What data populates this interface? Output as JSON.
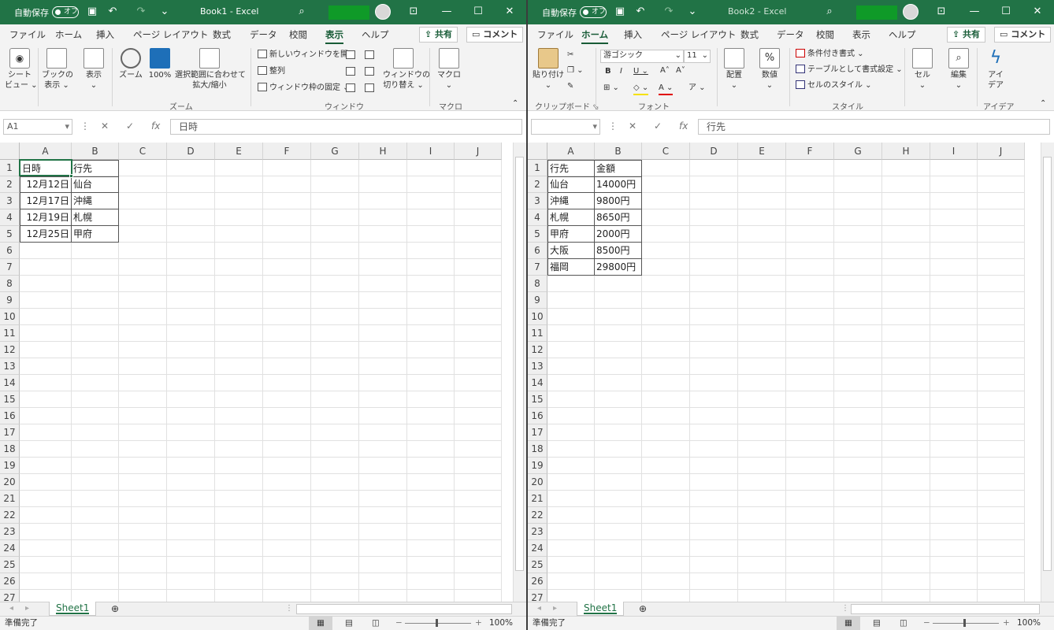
{
  "book1": {
    "autosave": "自動保存",
    "autosave_state": "オフ",
    "title": "Book1  -  Excel",
    "menu": [
      "ファイル",
      "ホーム",
      "挿入",
      "ページ レイアウト",
      "数式",
      "データ",
      "校閲",
      "表示",
      "ヘルプ"
    ],
    "active_tab": "表示",
    "share": "共有",
    "comment": "コメント",
    "ribbon": {
      "sheet_view_1": "シート",
      "sheet_view_2": "ビュー ⌄",
      "book_view_1": "ブックの",
      "book_view_2": "表示 ⌄",
      "show_1": "表示",
      "zoom": "ズーム",
      "zoom100": "100%",
      "fit_1": "選択範囲に合わせて",
      "fit_2": "拡大/縮小",
      "new_window": "新しいウィンドウを開く",
      "arrange": "整列",
      "freeze": "ウィンドウ枠の固定 ⌄",
      "switch_1": "ウィンドウの",
      "switch_2": "切り替え ⌄",
      "macro": "マクロ",
      "group_zoom": "ズーム",
      "group_window": "ウィンドウ",
      "group_macro": "マクロ"
    },
    "namebox": "A1",
    "formula": "日時",
    "columns": [
      "A",
      "B",
      "C",
      "D",
      "E",
      "F",
      "G",
      "H",
      "I",
      "J"
    ],
    "rows": [
      "1",
      "2",
      "3",
      "4",
      "5",
      "6",
      "7",
      "8",
      "9",
      "10",
      "11",
      "12",
      "13",
      "14",
      "15",
      "16",
      "17",
      "18",
      "19",
      "20",
      "21",
      "22",
      "23",
      "24",
      "25",
      "26",
      "27"
    ],
    "table": [
      [
        "日時",
        "行先"
      ],
      [
        "12月12日",
        "仙台"
      ],
      [
        "12月17日",
        "沖縄"
      ],
      [
        "12月19日",
        "札幌"
      ],
      [
        "12月25日",
        "甲府"
      ]
    ],
    "sheet": "Sheet1",
    "status": "準備完了",
    "zoom_level": "100%"
  },
  "book2": {
    "autosave": "自動保存",
    "autosave_state": "オフ",
    "title": "Book2  -  Excel",
    "menu": [
      "ファイル",
      "ホーム",
      "挿入",
      "ページ レイアウト",
      "数式",
      "データ",
      "校閲",
      "表示",
      "ヘルプ"
    ],
    "active_tab": "ホーム",
    "share": "共有",
    "comment": "コメント",
    "ribbon": {
      "paste": "貼り付け",
      "font_name": "游ゴシック",
      "font_size": "11",
      "align": "配置",
      "number": "数値",
      "cond_format": "条件付き書式 ⌄",
      "table_format": "テーブルとして書式設定 ⌄",
      "cell_style": "セルのスタイル ⌄",
      "cells": "セル",
      "edit": "編集",
      "idea_1": "アイ",
      "idea_2": "デア",
      "group_clipboard": "クリップボード",
      "group_font": "フォント",
      "group_style": "スタイル",
      "group_idea": "アイデア"
    },
    "namebox": "",
    "formula": "行先",
    "columns": [
      "A",
      "B",
      "C",
      "D",
      "E",
      "F",
      "G",
      "H",
      "I",
      "J"
    ],
    "rows": [
      "1",
      "2",
      "3",
      "4",
      "5",
      "6",
      "7",
      "8",
      "9",
      "10",
      "11",
      "12",
      "13",
      "14",
      "15",
      "16",
      "17",
      "18",
      "19",
      "20",
      "21",
      "22",
      "23",
      "24",
      "25",
      "26",
      "27"
    ],
    "table": [
      [
        "行先",
        "金額"
      ],
      [
        "仙台",
        "14000円"
      ],
      [
        "沖縄",
        "9800円"
      ],
      [
        "札幌",
        "8650円"
      ],
      [
        "甲府",
        "2000円"
      ],
      [
        "大阪",
        "8500円"
      ],
      [
        "福岡",
        "29800円"
      ]
    ],
    "sheet": "Sheet1",
    "status": "準備完了",
    "zoom_level": "100%"
  },
  "colors": {
    "excel_green": "#217346",
    "tab_green": "#185c37"
  }
}
